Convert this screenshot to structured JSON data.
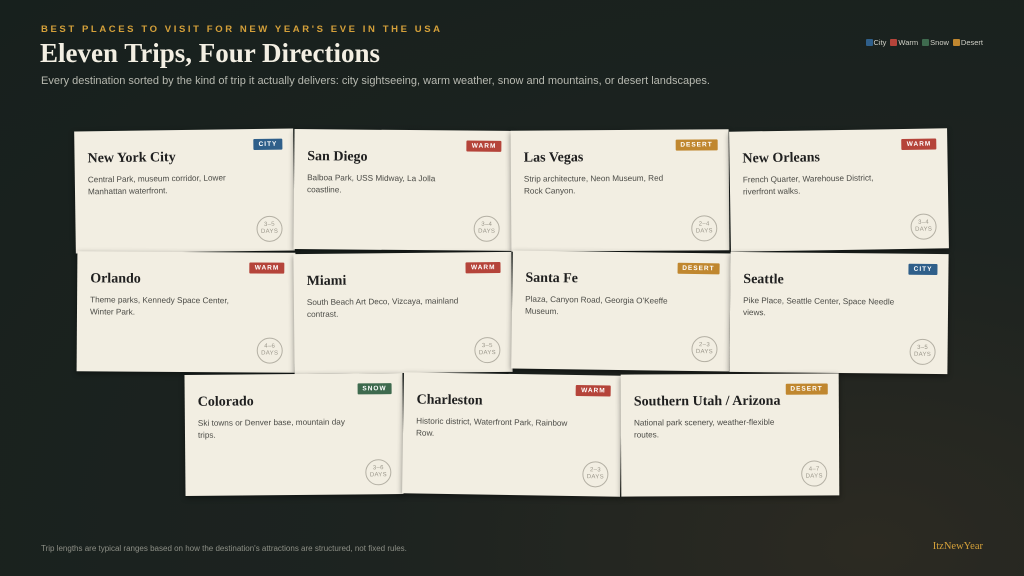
{
  "header": {
    "eyebrow": "BEST PLACES TO VISIT FOR NEW YEAR'S EVE IN THE USA",
    "title": "Eleven Trips, Four Directions",
    "subtitle": "Every destination sorted by the kind of trip it actually delivers: city sightseeing, warm weather, snow and mountains, or desert landscapes."
  },
  "legend": [
    {
      "label": "City",
      "color": "#2f5f8a"
    },
    {
      "label": "Warm",
      "color": "#b5443a"
    },
    {
      "label": "Snow",
      "color": "#3e6a4e"
    },
    {
      "label": "Desert",
      "color": "#c0872f"
    }
  ],
  "cards": [
    {
      "name": "New York City",
      "desc": "Central Park, museum corridor, Lower Manhattan waterfront.",
      "tag": "CITY",
      "days": "3–5",
      "days_unit": "DAYS",
      "color": "#2f5f8a"
    },
    {
      "name": "San Diego",
      "desc": "Balboa Park, USS Midway, La Jolla coastline.",
      "tag": "WARM",
      "days": "3–4",
      "days_unit": "DAYS",
      "color": "#b5443a"
    },
    {
      "name": "Las Vegas",
      "desc": "Strip architecture, Neon Museum, Red Rock Canyon.",
      "tag": "DESERT",
      "days": "2–4",
      "days_unit": "DAYS",
      "color": "#c0872f"
    },
    {
      "name": "New Orleans",
      "desc": "French Quarter, Warehouse District, riverfront walks.",
      "tag": "WARM",
      "days": "3–4",
      "days_unit": "DAYS",
      "color": "#b5443a"
    },
    {
      "name": "Orlando",
      "desc": "Theme parks, Kennedy Space Center, Winter Park.",
      "tag": "WARM",
      "days": "4–6",
      "days_unit": "DAYS",
      "color": "#b5443a"
    },
    {
      "name": "Miami",
      "desc": "South Beach Art Deco, Vizcaya, mainland contrast.",
      "tag": "WARM",
      "days": "3–5",
      "days_unit": "DAYS",
      "color": "#b5443a"
    },
    {
      "name": "Santa Fe",
      "desc": "Plaza, Canyon Road, Georgia O'Keeffe Museum.",
      "tag": "DESERT",
      "days": "2–3",
      "days_unit": "DAYS",
      "color": "#c0872f"
    },
    {
      "name": "Seattle",
      "desc": "Pike Place, Seattle Center, Space Needle views.",
      "tag": "CITY",
      "days": "3–5",
      "days_unit": "DAYS",
      "color": "#2f5f8a"
    },
    {
      "name": "Colorado",
      "desc": "Ski towns or Denver base, mountain day trips.",
      "tag": "SNOW",
      "days": "3–6",
      "days_unit": "DAYS",
      "color": "#3e6a4e"
    },
    {
      "name": "Charleston",
      "desc": "Historic district, Waterfront Park, Rainbow Row.",
      "tag": "WARM",
      "days": "2–3",
      "days_unit": "DAYS",
      "color": "#b5443a"
    },
    {
      "name": "Southern Utah / Arizona",
      "desc": "National park scenery, weather-flexible routes.",
      "tag": "DESERT",
      "days": "4–7",
      "days_unit": "DAYS",
      "color": "#c0872f"
    }
  ],
  "footer": {
    "note": "Trip lengths are typical ranges based on how the destination's attractions are structured, not fixed rules.",
    "brand": "ItzNewYear"
  }
}
